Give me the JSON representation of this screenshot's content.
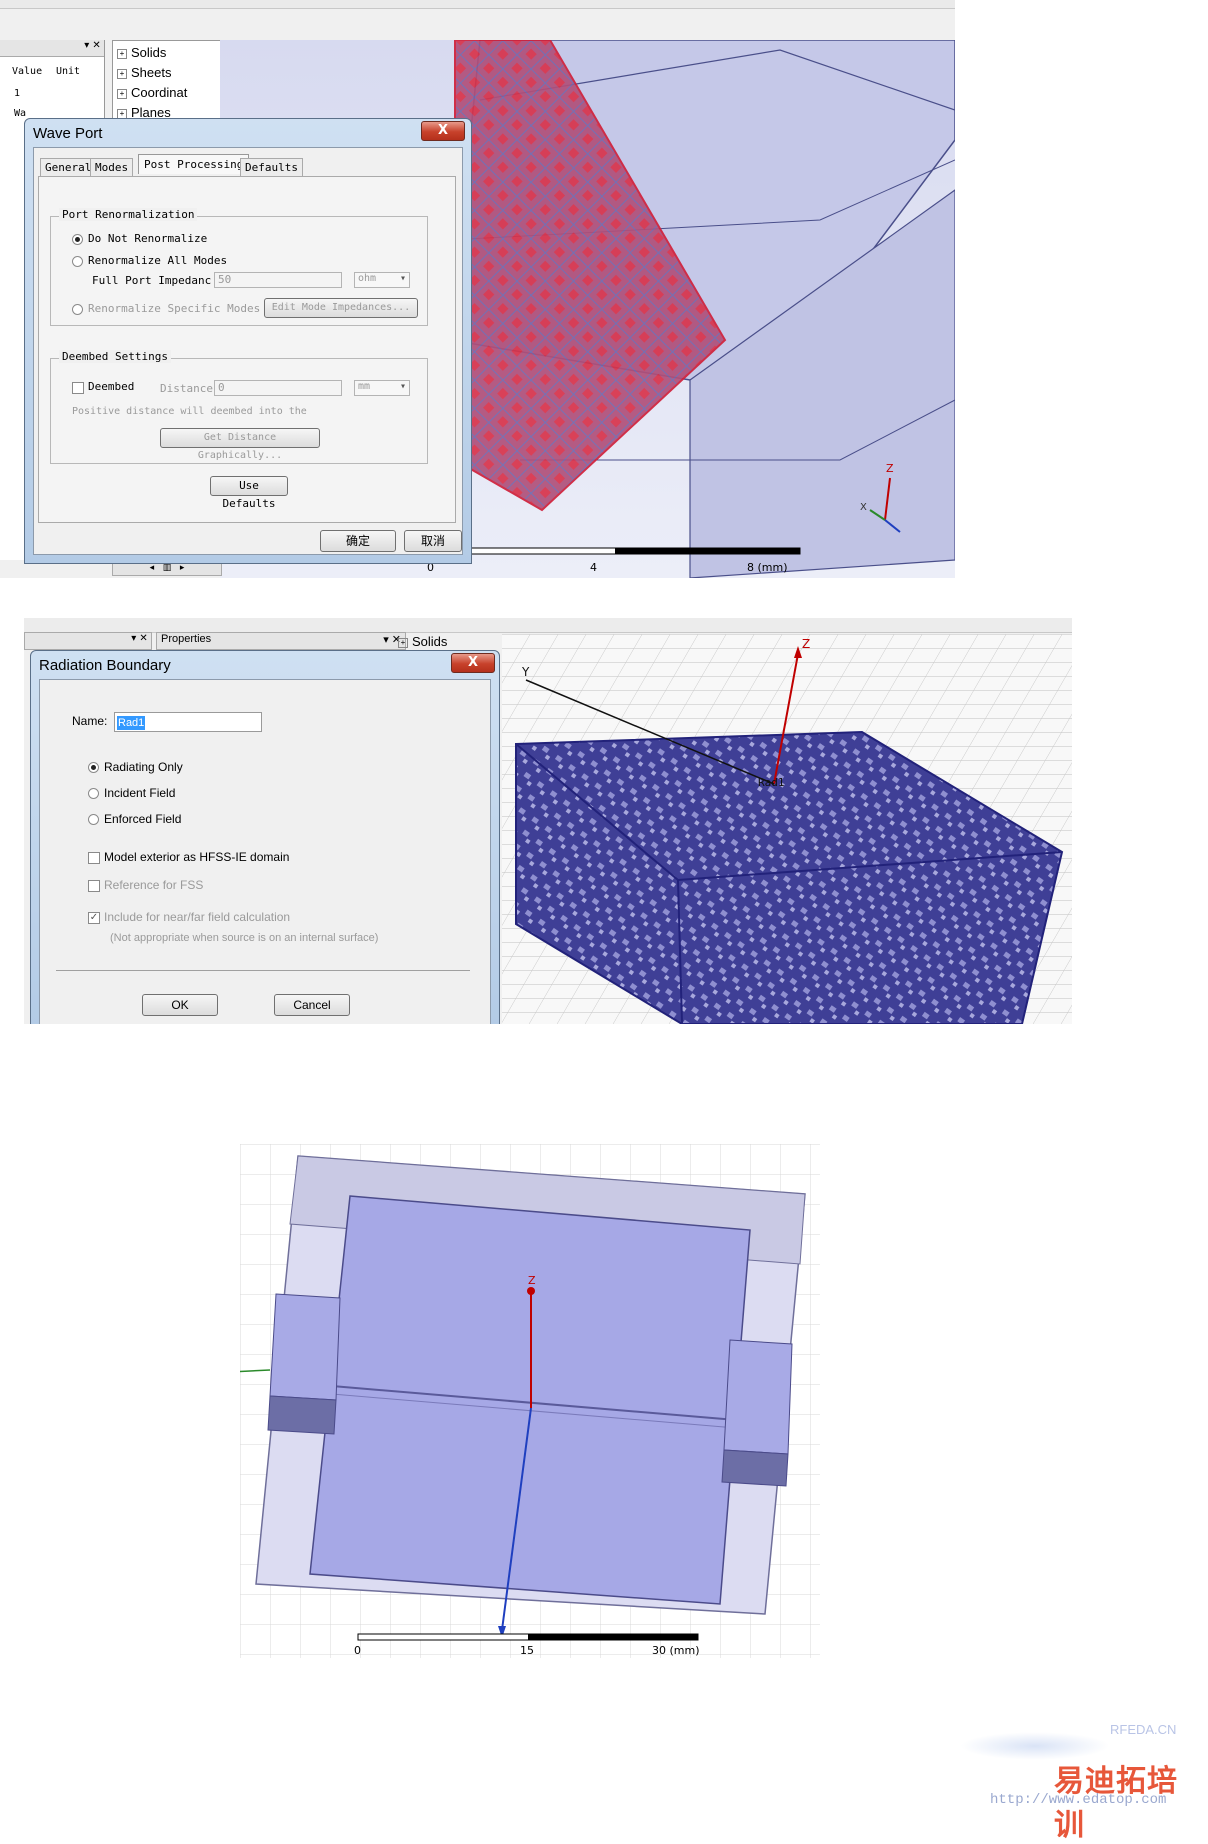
{
  "shot1": {
    "tree": [
      "Solids",
      "Sheets",
      "Coordinat",
      "Planes"
    ],
    "table": {
      "headers": [
        "Value",
        "Unit"
      ],
      "rows": [
        "1",
        "Wa"
      ]
    },
    "dialog": {
      "title": "Wave Port",
      "tabs": [
        "General",
        "Modes",
        "Post Processing",
        "Defaults"
      ],
      "active_tab": 2,
      "renorm_group": "Port Renormalization",
      "opt_no_renorm": "Do Not Renormalize",
      "opt_renorm_all": "Renormalize All Modes",
      "full_port_label": "Full Port Impedanc",
      "full_port_value": "50",
      "full_port_unit": "ohm",
      "opt_renorm_specific": "Renormalize Specific Modes",
      "edit_mode_btn": "Edit Mode Impedances...",
      "deembed_group": "Deembed Settings",
      "deembed_label": "Deembed",
      "distance_label": "Distance",
      "distance_value": "0",
      "distance_unit": "mm",
      "hint": "Positive distance will deembed into the",
      "get_distance_btn": "Get Distance Graphically...",
      "use_defaults_btn": "Use Defaults",
      "ok_btn": "确定",
      "cancel_btn": "取消",
      "close_btn": "X"
    },
    "scale": {
      "t0": "0",
      "t1": "4",
      "t2": "8 (mm)"
    },
    "axes": {
      "z": "Z",
      "x": "X"
    }
  },
  "shot2": {
    "toolbar_props": "Properties",
    "tree_solids": "Solids",
    "dialog": {
      "title": "Radiation Boundary",
      "name_label": "Name:",
      "name_value": "Rad1",
      "opt_radiating": "Radiating Only",
      "opt_incident": "Incident Field",
      "opt_enforced": "Enforced Field",
      "chk_exterior": "Model exterior as HFSS-IE domain",
      "chk_fss": "Reference for FSS",
      "chk_include": "Include for near/far field calculation",
      "note": "(Not appropriate when source is on an internal surface)",
      "ok_btn": "OK",
      "cancel_btn": "Cancel",
      "close_btn": "X"
    },
    "viewport_label": "Rad1",
    "axes": {
      "z": "Z",
      "y": "Y"
    }
  },
  "shot3": {
    "axes": {
      "z": "Z"
    },
    "scale": {
      "t0": "0",
      "t1": "15",
      "t2": "30 (mm)"
    }
  },
  "watermark": {
    "site": "RFEDA.CN",
    "brand": "易迪拓培训",
    "url": "http://www.edatop.com"
  },
  "colors": {
    "model_fill": "#9fa3e6",
    "mesh_blue": "#2f2f8f",
    "port_red": "#c9354a",
    "axis_red": "#c00000",
    "axis_blue": "#1f3fbf"
  }
}
